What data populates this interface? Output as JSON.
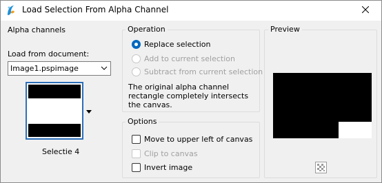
{
  "window": {
    "title": "Load Selection From Alpha Channel",
    "close_icon": "close-icon",
    "app_icon": "paintshop-pro-icon"
  },
  "alpha_channels": {
    "group_title": "Alpha channels",
    "load_from_label": "Load from document:",
    "document_value": "Image1.pspimage",
    "selection_name": "Selectie 4"
  },
  "operation": {
    "group_title": "Operation",
    "options": [
      {
        "label": "Replace selection",
        "checked": true,
        "enabled": true
      },
      {
        "label": "Add to current selection",
        "checked": false,
        "enabled": false
      },
      {
        "label": "Subtract from current selection",
        "checked": false,
        "enabled": false
      }
    ],
    "description": "The original alpha channel rectangle completely intersects the canvas."
  },
  "options": {
    "group_title": "Options",
    "checkboxes": [
      {
        "label": "Move to upper left of canvas",
        "checked": false,
        "enabled": true
      },
      {
        "label": "Clip to canvas",
        "checked": false,
        "enabled": false
      },
      {
        "label": "Invert image",
        "checked": false,
        "enabled": true
      }
    ]
  },
  "preview": {
    "group_title": "Preview",
    "transparency_icon": "checkerboard-icon"
  },
  "colors": {
    "accent": "#0067c0",
    "selection_border": "#2b6fb8"
  }
}
